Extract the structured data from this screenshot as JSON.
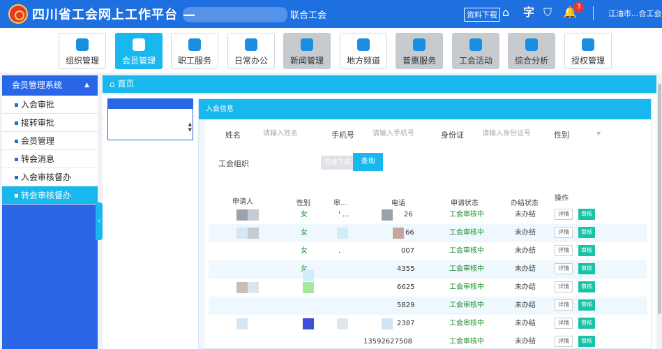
{
  "header": {
    "title": "四川省工会网上工作平台",
    "title_suffix": "—",
    "org_name": "联合工会",
    "download_label": "资料下载",
    "icons": [
      "home-icon",
      "font-size-icon",
      "shirt-icon",
      "bell-icon"
    ],
    "notification_count": "3",
    "user_label": "江油市...合工会",
    "accent": "#1e6fe0"
  },
  "modules": [
    {
      "label": "组织管理",
      "icon": "org-tree-icon",
      "state": "normal"
    },
    {
      "label": "会员管理",
      "icon": "user-icon",
      "state": "active"
    },
    {
      "label": "职工服务",
      "icon": "heart-hand-icon",
      "state": "normal"
    },
    {
      "label": "日常办公",
      "icon": "calendar-icon",
      "state": "normal"
    },
    {
      "label": "新闻管理",
      "icon": "grid-icon",
      "state": "disabled"
    },
    {
      "label": "地方频道",
      "icon": "channel-icon",
      "state": "normal"
    },
    {
      "label": "普惠服务",
      "icon": "globe-icon",
      "state": "disabled"
    },
    {
      "label": "工会活动",
      "icon": "clover-icon",
      "state": "disabled"
    },
    {
      "label": "综合分析",
      "icon": "monitor-icon",
      "state": "disabled"
    },
    {
      "label": "授权管理",
      "icon": "key-icon",
      "state": "normal"
    }
  ],
  "sidebar": {
    "header": "会员管理系统",
    "items": [
      {
        "label": "入会审批",
        "active": false
      },
      {
        "label": "接转审批",
        "active": false
      },
      {
        "label": "会员管理",
        "active": false
      },
      {
        "label": "转会消息",
        "active": false
      },
      {
        "label": "入会审核督办",
        "active": false
      },
      {
        "label": "转会审核督办",
        "active": true
      }
    ]
  },
  "breadcrumb": {
    "label": "首页"
  },
  "panel": {
    "title": "入会信息",
    "form": {
      "name_label": "姓名",
      "name_placeholder": "请输入姓名",
      "phone_label": "手机号",
      "phone_placeholder": "请输入手机号",
      "id_label": "身份证",
      "id_placeholder": "请输入身份证号",
      "gender_label": "性别",
      "org_label": "工会组织",
      "include_label": "包含下级",
      "query_label": "查询"
    },
    "table": {
      "headers": [
        "申请人",
        "性别",
        "审...",
        "电话",
        "申请状态",
        "办结状态",
        "操作"
      ],
      "rows": [
        {
          "gender": "女",
          "audit": "' ...",
          "phone": "26",
          "status": "工会审核中",
          "done": "未办结"
        },
        {
          "gender": "女",
          "audit": "",
          "phone": "66",
          "status": "工会审核中",
          "done": "未办结"
        },
        {
          "gender": "女",
          "audit": ".",
          "phone": "007",
          "status": "工会审核中",
          "done": "未办结"
        },
        {
          "gender": "女",
          "audit": "",
          "phone": "4355",
          "status": "工会审核中",
          "done": "未办结"
        },
        {
          "gender": "",
          "audit": "",
          "phone": "6625",
          "status": "工会审核中",
          "done": "未办结"
        },
        {
          "gender": "",
          "audit": "",
          "phone": "5829",
          "status": "工会审核中",
          "done": "未办结"
        },
        {
          "gender": "",
          "audit": "",
          "phone": "2387",
          "status": "工会审核中",
          "done": "未办结"
        },
        {
          "gender": "",
          "audit": "",
          "phone": "13592627508",
          "status": "工会审核中",
          "done": "未办结"
        }
      ],
      "detail_label": "详情",
      "audit_label": "审核"
    }
  }
}
